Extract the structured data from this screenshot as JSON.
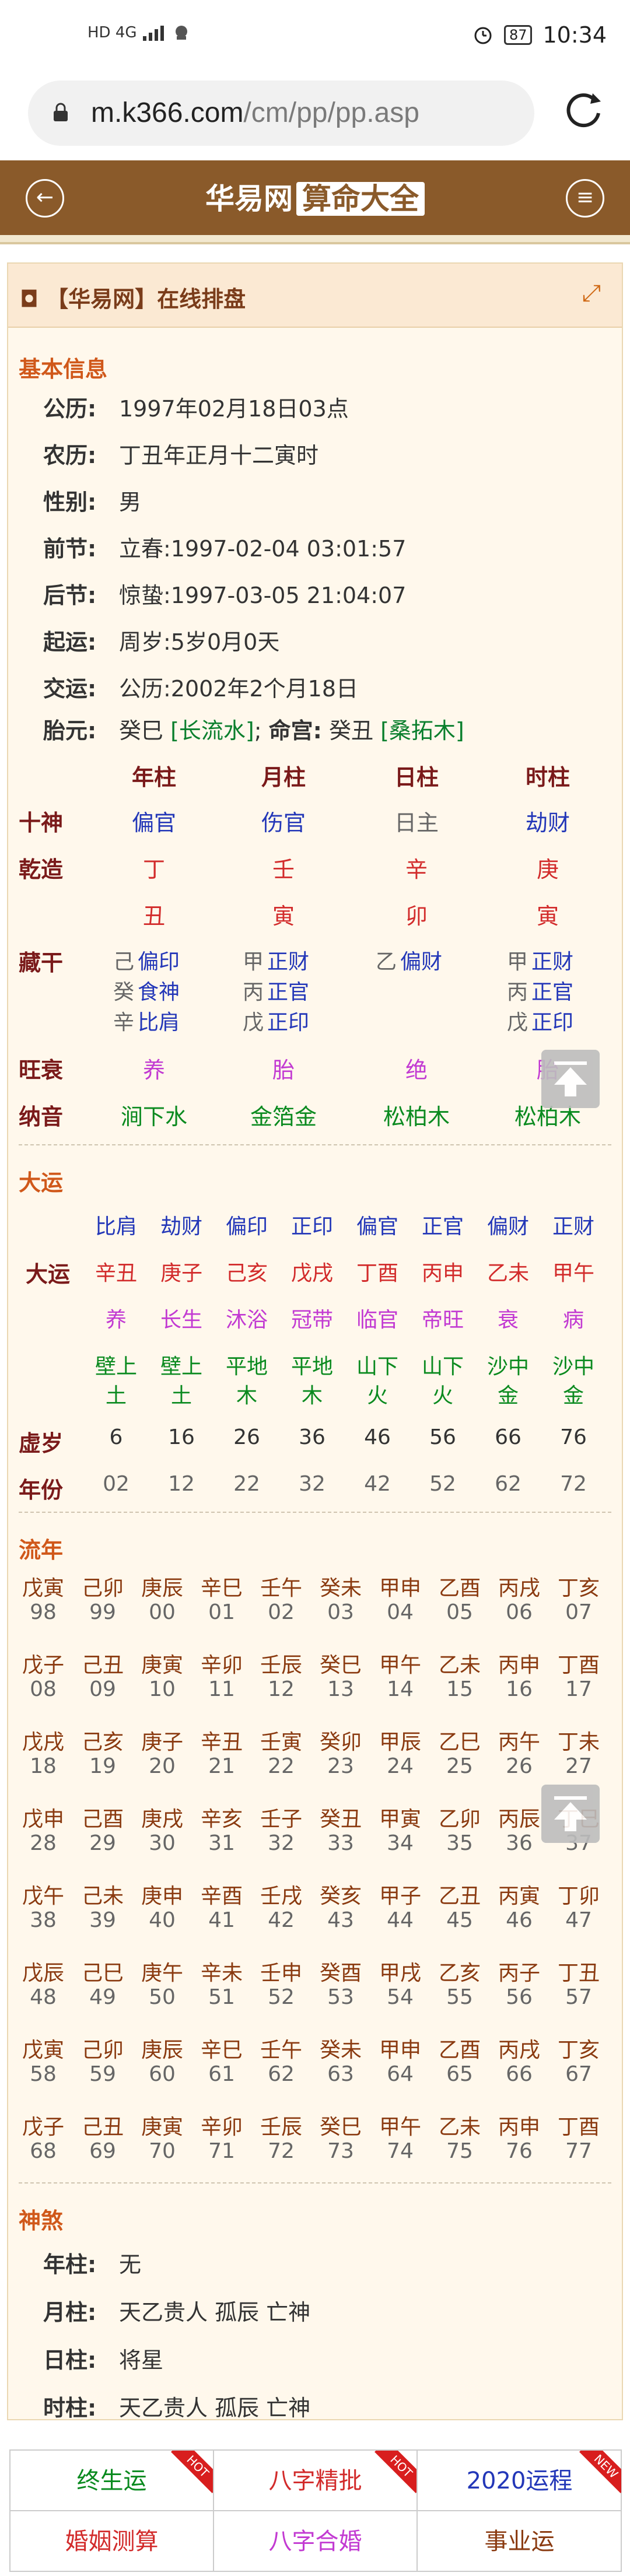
{
  "status_bar": {
    "signal": "HD 4G",
    "time": "10:34",
    "battery": "87"
  },
  "browser": {
    "url_host": "m.k366.com",
    "url_path": "/cm/pp/pp.asp"
  },
  "header": {
    "title": "华易网",
    "tag": "算命大全",
    "back_icon": "back-arrow-icon",
    "menu_icon": "menu-icon"
  },
  "panel": {
    "title": "【华易网】在线排盘"
  },
  "basic": {
    "heading": "基本信息",
    "rows": [
      {
        "label": "公历:",
        "value": "1997年02月18日03点"
      },
      {
        "label": "农历:",
        "value": "丁丑年正月十二寅时"
      },
      {
        "label": "性别:",
        "value": "男"
      },
      {
        "label": "前节:",
        "value": "立春:1997-02-04 03:01:57"
      },
      {
        "label": "后节:",
        "value": "惊蛰:1997-03-05 21:04:07"
      },
      {
        "label": "起运:",
        "value": "周岁:5岁0月0天"
      },
      {
        "label": "交运:",
        "value": "公历:2002年2个月18日"
      }
    ],
    "taiyuan_label": "胎元:",
    "taiyuan": "癸巳",
    "taiyuan_nayin": "[长流水]",
    "sep": ";",
    "minggong_label": "命宫:",
    "minggong": "癸丑",
    "minggong_nayin": "[桑拓木]"
  },
  "pillars": {
    "headers": [
      "年柱",
      "月柱",
      "日柱",
      "时柱"
    ],
    "shishen_label": "十神",
    "shishen": [
      "偏官",
      "伤官",
      "日主",
      "劫财"
    ],
    "qianzao_label": "乾造",
    "gan": [
      "丁",
      "壬",
      "辛",
      "庚"
    ],
    "zhi": [
      "丑",
      "寅",
      "卯",
      "寅"
    ],
    "canggan_label": "藏干",
    "canggan": [
      [
        [
          "己",
          "偏印"
        ],
        [
          "癸",
          "食神"
        ],
        [
          "辛",
          "比肩"
        ]
      ],
      [
        [
          "甲",
          "正财"
        ],
        [
          "丙",
          "正官"
        ],
        [
          "戊",
          "正印"
        ]
      ],
      [
        [
          "乙",
          "偏财"
        ]
      ],
      [
        [
          "甲",
          "正财"
        ],
        [
          "丙",
          "正官"
        ],
        [
          "戊",
          "正印"
        ]
      ]
    ],
    "wangshuai_label": "旺衰",
    "wangshuai": [
      "养",
      "胎",
      "绝",
      "胎"
    ],
    "nayin_label": "纳音",
    "nayin": [
      "涧下水",
      "金箔金",
      "松柏木",
      "松柏木"
    ]
  },
  "dayun": {
    "heading": "大运",
    "shishen": [
      "比肩",
      "劫财",
      "偏印",
      "正印",
      "偏官",
      "正官",
      "偏财",
      "正财"
    ],
    "label": "大运",
    "ganzhi": [
      "辛丑",
      "庚子",
      "己亥",
      "戊戌",
      "丁酉",
      "丙申",
      "乙未",
      "甲午"
    ],
    "state": [
      "养",
      "长生",
      "沐浴",
      "冠带",
      "临官",
      "帝旺",
      "衰",
      "病"
    ],
    "nayin1": [
      "壁上",
      "壁上",
      "平地",
      "平地",
      "山下",
      "山下",
      "沙中",
      "沙中"
    ],
    "nayin2": [
      "土",
      "土",
      "木",
      "木",
      "火",
      "火",
      "金",
      "金"
    ],
    "age_label": "虚岁",
    "ages": [
      "6",
      "16",
      "26",
      "36",
      "46",
      "56",
      "66",
      "76"
    ],
    "year_label": "年份",
    "years": [
      "02",
      "12",
      "22",
      "32",
      "42",
      "52",
      "62",
      "72"
    ]
  },
  "liunian": {
    "heading": "流年",
    "rows": [
      [
        [
          "戊寅",
          "98"
        ],
        [
          "己卯",
          "99"
        ],
        [
          "庚辰",
          "00"
        ],
        [
          "辛巳",
          "01"
        ],
        [
          "壬午",
          "02"
        ],
        [
          "癸未",
          "03"
        ],
        [
          "甲申",
          "04"
        ],
        [
          "乙酉",
          "05"
        ],
        [
          "丙戌",
          "06"
        ],
        [
          "丁亥",
          "07"
        ]
      ],
      [
        [
          "戊子",
          "08"
        ],
        [
          "己丑",
          "09"
        ],
        [
          "庚寅",
          "10"
        ],
        [
          "辛卯",
          "11"
        ],
        [
          "壬辰",
          "12"
        ],
        [
          "癸巳",
          "13"
        ],
        [
          "甲午",
          "14"
        ],
        [
          "乙未",
          "15"
        ],
        [
          "丙申",
          "16"
        ],
        [
          "丁酉",
          "17"
        ]
      ],
      [
        [
          "戊戌",
          "18"
        ],
        [
          "己亥",
          "19"
        ],
        [
          "庚子",
          "20"
        ],
        [
          "辛丑",
          "21"
        ],
        [
          "壬寅",
          "22"
        ],
        [
          "癸卯",
          "23"
        ],
        [
          "甲辰",
          "24"
        ],
        [
          "乙巳",
          "25"
        ],
        [
          "丙午",
          "26"
        ],
        [
          "丁未",
          "27"
        ]
      ],
      [
        [
          "戊申",
          "28"
        ],
        [
          "己酉",
          "29"
        ],
        [
          "庚戌",
          "30"
        ],
        [
          "辛亥",
          "31"
        ],
        [
          "壬子",
          "32"
        ],
        [
          "癸丑",
          "33"
        ],
        [
          "甲寅",
          "34"
        ],
        [
          "乙卯",
          "35"
        ],
        [
          "丙辰",
          "36"
        ],
        [
          "丁巳",
          "37"
        ]
      ],
      [
        [
          "戊午",
          "38"
        ],
        [
          "己未",
          "39"
        ],
        [
          "庚申",
          "40"
        ],
        [
          "辛酉",
          "41"
        ],
        [
          "壬戌",
          "42"
        ],
        [
          "癸亥",
          "43"
        ],
        [
          "甲子",
          "44"
        ],
        [
          "乙丑",
          "45"
        ],
        [
          "丙寅",
          "46"
        ],
        [
          "丁卯",
          "47"
        ]
      ],
      [
        [
          "戊辰",
          "48"
        ],
        [
          "己巳",
          "49"
        ],
        [
          "庚午",
          "50"
        ],
        [
          "辛未",
          "51"
        ],
        [
          "壬申",
          "52"
        ],
        [
          "癸酉",
          "53"
        ],
        [
          "甲戌",
          "54"
        ],
        [
          "乙亥",
          "55"
        ],
        [
          "丙子",
          "56"
        ],
        [
          "丁丑",
          "57"
        ]
      ],
      [
        [
          "戊寅",
          "58"
        ],
        [
          "己卯",
          "59"
        ],
        [
          "庚辰",
          "60"
        ],
        [
          "辛巳",
          "61"
        ],
        [
          "壬午",
          "62"
        ],
        [
          "癸未",
          "63"
        ],
        [
          "甲申",
          "64"
        ],
        [
          "乙酉",
          "65"
        ],
        [
          "丙戌",
          "66"
        ],
        [
          "丁亥",
          "67"
        ]
      ],
      [
        [
          "戊子",
          "68"
        ],
        [
          "己丑",
          "69"
        ],
        [
          "庚寅",
          "70"
        ],
        [
          "辛卯",
          "71"
        ],
        [
          "壬辰",
          "72"
        ],
        [
          "癸巳",
          "73"
        ],
        [
          "甲午",
          "74"
        ],
        [
          "乙未",
          "75"
        ],
        [
          "丙申",
          "76"
        ],
        [
          "丁酉",
          "77"
        ]
      ]
    ]
  },
  "shensha": {
    "heading": "神煞",
    "rows": [
      {
        "label": "年柱:",
        "value": "无"
      },
      {
        "label": "月柱:",
        "value": "天乙贵人 孤辰 亡神"
      },
      {
        "label": "日柱:",
        "value": "将星"
      },
      {
        "label": "时柱:",
        "value": "天乙贵人 孤辰 亡神"
      }
    ]
  },
  "bottom_nav": [
    {
      "label": "终生运",
      "color": "#0a8a1f",
      "badge": "HOT"
    },
    {
      "label": "八字精批",
      "color": "#d22b2b",
      "badge": "HOT"
    },
    {
      "label": "2020运程",
      "color": "#2337b8",
      "badge": "NEW"
    },
    {
      "label": "婚姻测算",
      "color": "#d22b2b",
      "badge": ""
    },
    {
      "label": "八字合婚",
      "color": "#c23ad2",
      "badge": ""
    },
    {
      "label": "事业运",
      "color": "#8a3a10",
      "badge": ""
    }
  ]
}
